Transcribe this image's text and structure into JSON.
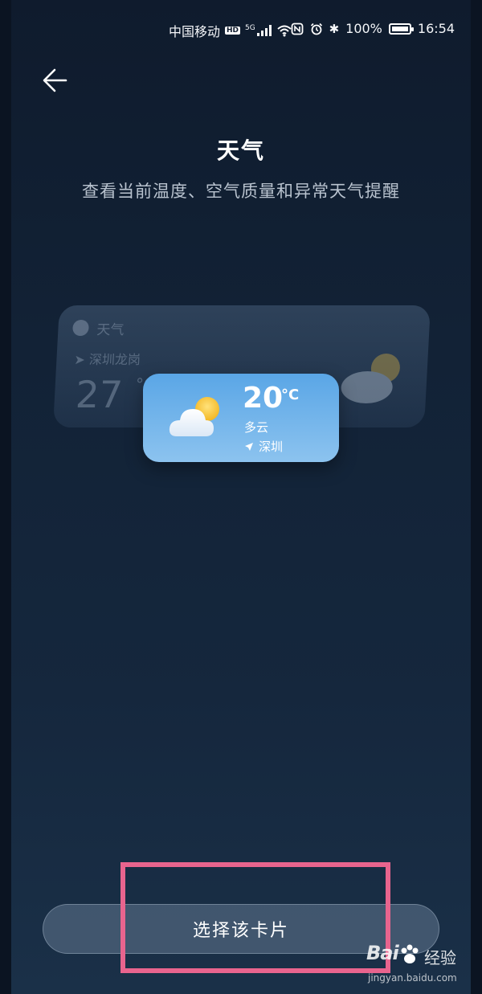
{
  "status_bar": {
    "carrier": "中国移动",
    "hd_badge": "HD",
    "network": "5G",
    "battery": "100%",
    "battery_level": 1.0,
    "time": "16:54",
    "icons": [
      "wifi-icon",
      "nfc-icon",
      "alarm-icon",
      "bluetooth-icon",
      "battery-icon"
    ]
  },
  "header": {
    "back_icon": "arrow-left-icon",
    "title": "天气",
    "subtitle": "查看当前温度、空气质量和异常天气提醒"
  },
  "preview_back_card": {
    "app_name": "天气",
    "location": "深圳龙岗",
    "temperature": "27",
    "unit": "°C"
  },
  "preview_front_card": {
    "temperature": "20",
    "unit": "°C",
    "condition": "多云",
    "location": "深圳",
    "weather_icon": "partly-cloudy-icon"
  },
  "action": {
    "select_label": "选择该卡片"
  },
  "watermark": {
    "brand": "Bai",
    "name": "经验",
    "url": "jingyan.baidu.com"
  },
  "colors": {
    "accent_highlight": "#e8648e",
    "card_blue": "#5aa6e6"
  }
}
